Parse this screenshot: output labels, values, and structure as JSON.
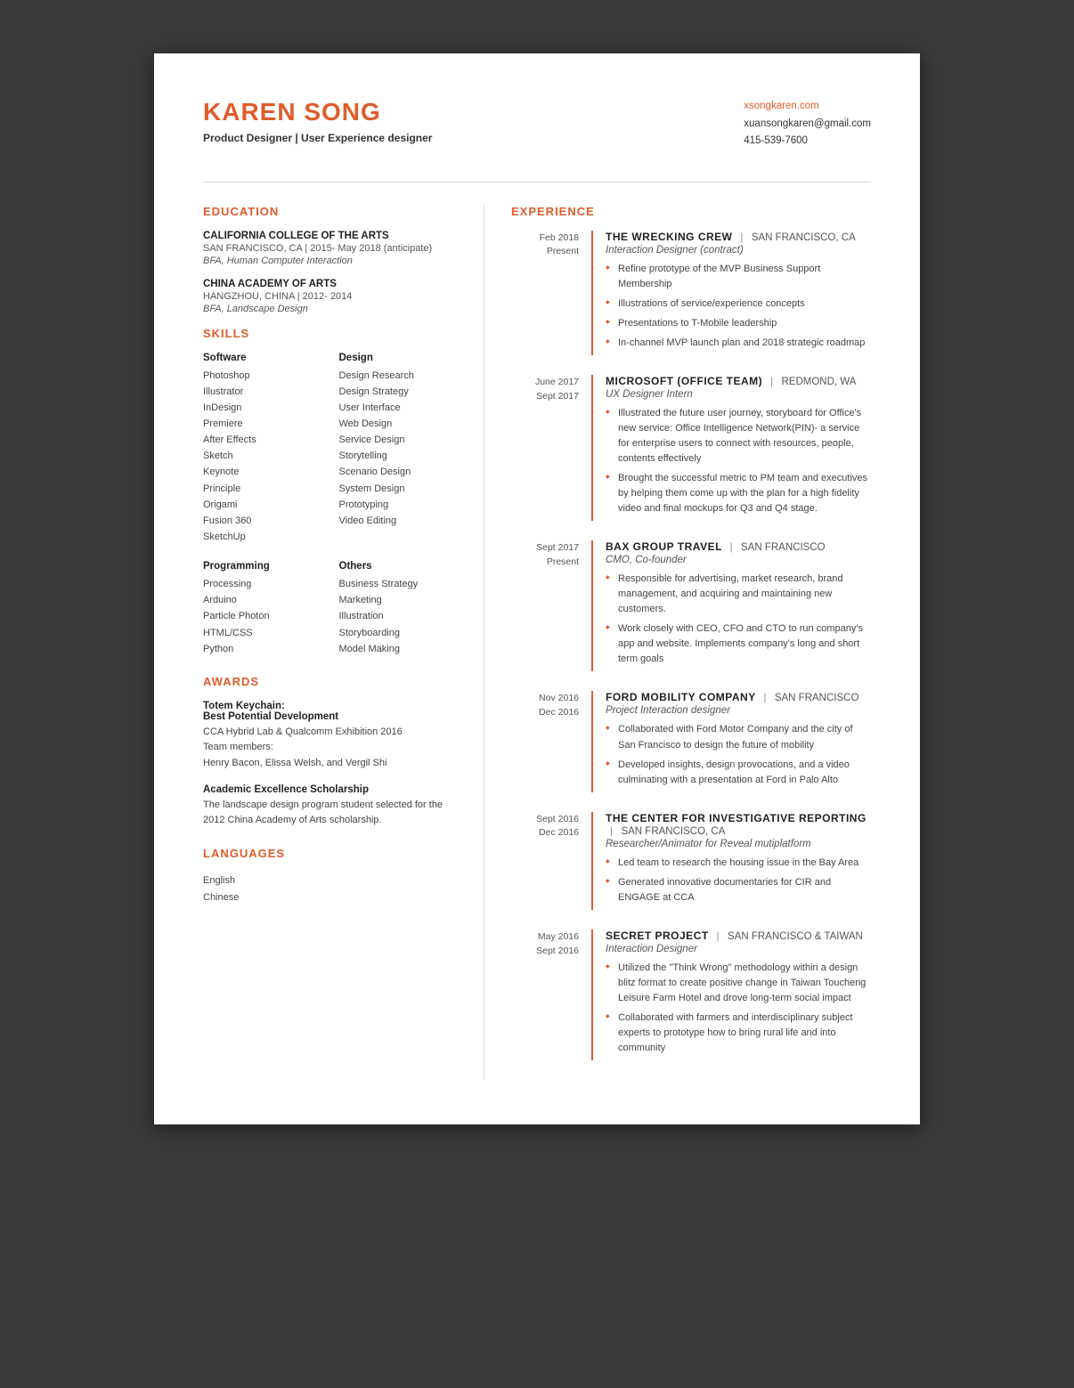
{
  "header": {
    "name": "KAREN SONG",
    "title": "Product Designer | User Experience designer",
    "website": "xsongkaren.com",
    "email": "xuansongkaren@gmail.com",
    "phone": "415-539-7600"
  },
  "sections": {
    "education_title": "EDUCATION",
    "experience_title": "EXPERIENCE",
    "skills_title": "SKILLS",
    "awards_title": "AWARDS",
    "languages_title": "LANGUAGES"
  },
  "education": [
    {
      "org": "CALIFORNIA COLLEGE OF THE ARTS",
      "location": "SAN FRANCISCO, CA  |  2015- May 2018 (anticipate)",
      "degree": "BFA, Human Computer Interaction"
    },
    {
      "org": "CHINA ACADEMY OF ARTS",
      "location": "HANGZHOU, CHINA  |  2012- 2014",
      "degree": "BFA, Landscape Design"
    }
  ],
  "skills": {
    "software": {
      "label": "Software",
      "items": [
        "Photoshop",
        "Illustrator",
        "InDesign",
        "Premiere",
        "After Effects",
        "Sketch",
        "Keynote",
        "Principle",
        "Origami",
        "Fusion 360",
        "SketchUp"
      ]
    },
    "design": {
      "label": "Design",
      "items": [
        "Design Research",
        "Design Strategy",
        "User Interface",
        "Web Design",
        "Service Design",
        "Storytelling",
        "Scenario Design",
        "System Design",
        "Prototyping",
        "Video Editing"
      ]
    },
    "programming": {
      "label": "Programming",
      "items": [
        "Processing",
        "Arduino",
        "Particle Photon",
        "HTML/CSS",
        "Python"
      ]
    },
    "others": {
      "label": "Others",
      "items": [
        "Business Strategy",
        "Marketing",
        "Illustration",
        "Storyboarding",
        "Model Making"
      ]
    }
  },
  "awards": [
    {
      "title": "Totem Keychain:\nBest Potential Development",
      "description": "CCA Hybrid Lab & Qualcomm Exhibition 2016\nTeam members:\nHenry Bacon, Elissa Welsh, and Vergil Shi"
    },
    {
      "title": "Academic Excellence Scholarship",
      "description": "The landscape design program student selected for the 2012 China Academy of Arts scholarship."
    }
  ],
  "languages": [
    "English",
    "Chinese"
  ],
  "experience": [
    {
      "date_start": "Feb 2018",
      "date_end": "Present",
      "org": "THE WRECKING CREW",
      "separator": "|",
      "location": "SAN FRANCISCO, CA",
      "role": "Interaction Designer (contract)",
      "bullets": [
        "Refine prototype of the MVP Business Support Membership",
        "Illustrations of service/experience concepts",
        "Presentations to T-Mobile leadership",
        "In-channel MVP launch plan and 2018 strategic roadmap"
      ]
    },
    {
      "date_start": "June 2017",
      "date_end": "Sept 2017",
      "org": "MICROSOFT (Office team)",
      "separator": "|",
      "location": "REDMOND, WA",
      "role": "UX Designer Intern",
      "bullets": [
        "Illustrated the future user journey, storyboard for Office's new service: Office Intelligence Network(PIN)- a service for enterprise users to connect with resources, people, contents effectively",
        "Brought the successful metric to PM team and executives by helping them come up with the plan for a high fidelity video and final mockups for Q3 and Q4 stage."
      ]
    },
    {
      "date_start": "Sept 2017",
      "date_end": "Present",
      "org": "BAX Group Travel",
      "separator": "|",
      "location": "SAN FRANCISCO",
      "role": "CMO, Co-founder",
      "bullets": [
        "Responsible for advertising, market research, brand management, and acquiring and maintaining new customers.",
        "Work closely with CEO, CFO and CTO to run company's app and website. Implements company's long and short term goals"
      ]
    },
    {
      "date_start": "Nov 2016",
      "date_end": "Dec 2016",
      "org": "FORD MOBILITY COMPANY",
      "separator": "|",
      "location": "SAN FRANCISCO",
      "role": "Project Interaction designer",
      "bullets": [
        "Collaborated with Ford Motor Company and the city of San Francisco to design the future of mobility",
        "Developed insights, design provocations, and a video culminating with a presentation at Ford in Palo Alto"
      ]
    },
    {
      "date_start": "Sept 2016",
      "date_end": "Dec 2016",
      "org": "THE CENTER FOR INVESTIGATIVE REPORTING",
      "separator": "|",
      "location": "SAN FRANCISCO, CA",
      "role": "Researcher/Animator for Reveal mutiplatform",
      "bullets": [
        "Led team to research the housing issue in the Bay Area",
        "Generated innovative documentaries for CIR and ENGAGE at CCA"
      ]
    },
    {
      "date_start": "May 2016",
      "date_end": "Sept 2016",
      "org": "SECRET PROJECT",
      "separator": "|",
      "location": "SAN FRANCISCO & TAIWAN",
      "role": "Interaction Designer",
      "bullets": [
        "Utilized the \"Think Wrong\" methodology within a design blitz format to create positive change in Taiwan Toucheng Leisure Farm Hotel and drove long-term social impact",
        "Collaborated with farmers and interdisciplinary subject experts  to prototype how to bring rural life and into community"
      ]
    }
  ]
}
